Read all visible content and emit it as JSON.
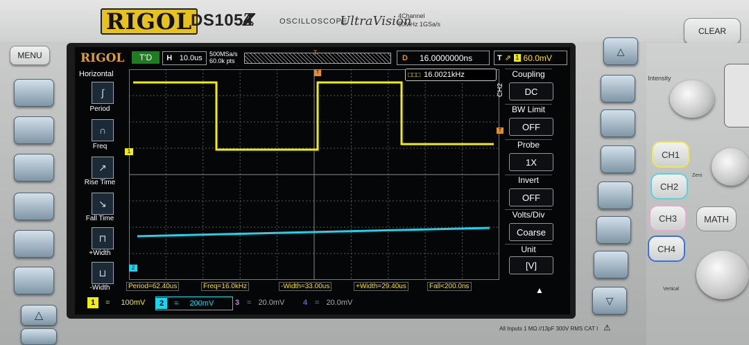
{
  "brand": {
    "logo": "RIGOL",
    "model": "DS1054",
    "model_suffix": "Z",
    "label": "OSCILLOSCOPE",
    "series": "UltraVision",
    "spec_line1": "4Channel",
    "spec_line2": "50MHz 1GSa/s"
  },
  "front_panel": {
    "menu": "MENU",
    "clear": "CLEAR",
    "intensity": "Intensity",
    "footer": "All Inputs 1 MΩ //13pF 300V RMS  CAT I",
    "vertical": "Vertical",
    "math": "MATH",
    "zero": "Zero"
  },
  "status": {
    "logo": "RIGOL",
    "run_state": "T'D",
    "timebase_label": "H",
    "timebase": "10.0us",
    "sample_rate": "500MSa/s",
    "memory_depth": "60.0k pts",
    "delay_label": "D",
    "delay": "16.0000000ns",
    "trigger_label": "T",
    "trigger_source": "1",
    "trigger_level": "60.0mV"
  },
  "left_menu": {
    "title": "Horizontal",
    "items": [
      {
        "label": "Period",
        "icon": "period-icon"
      },
      {
        "label": "Freq",
        "icon": "freq-icon"
      },
      {
        "label": "Rise Time",
        "icon": "rise-time-icon"
      },
      {
        "label": "Fall Time",
        "icon": "fall-time-icon"
      },
      {
        "label": "+Width",
        "icon": "pos-width-icon"
      },
      {
        "label": "-Width",
        "icon": "neg-width-icon"
      }
    ]
  },
  "freq_counter": {
    "value": "16.0021kHz"
  },
  "right_menu": {
    "channel": "CH2",
    "items": [
      {
        "title": "Coupling",
        "value": "DC"
      },
      {
        "title": "BW Limit",
        "value": "OFF"
      },
      {
        "title": "Probe",
        "value": "1X"
      },
      {
        "title": "Invert",
        "value": "OFF"
      },
      {
        "title": "Volts/Div",
        "value": "Coarse"
      },
      {
        "title": "Unit",
        "value": "[V]"
      }
    ]
  },
  "measurements": [
    "Period=62.40us",
    "Freq=16.0kHz",
    "-Width=33.00us",
    "+Width=29.40us",
    "Fall<200.0ns"
  ],
  "channels": [
    {
      "num": "1",
      "scale": "100mV",
      "color": "#f2ee00"
    },
    {
      "num": "2",
      "scale": "200mV",
      "color": "#19d6f0"
    },
    {
      "num": "3",
      "scale": "20.0mV",
      "color": "#d07be8"
    },
    {
      "num": "4",
      "scale": "20.0mV",
      "color": "#3b6fe0"
    }
  ],
  "markers": {
    "ch1": "1",
    "ch2": "2",
    "trigger": "T"
  },
  "colors": {
    "ch1": "#f2ee00",
    "ch2": "#19d6f0",
    "grid": "#6a6a6a",
    "accent": "#e0902a"
  }
}
